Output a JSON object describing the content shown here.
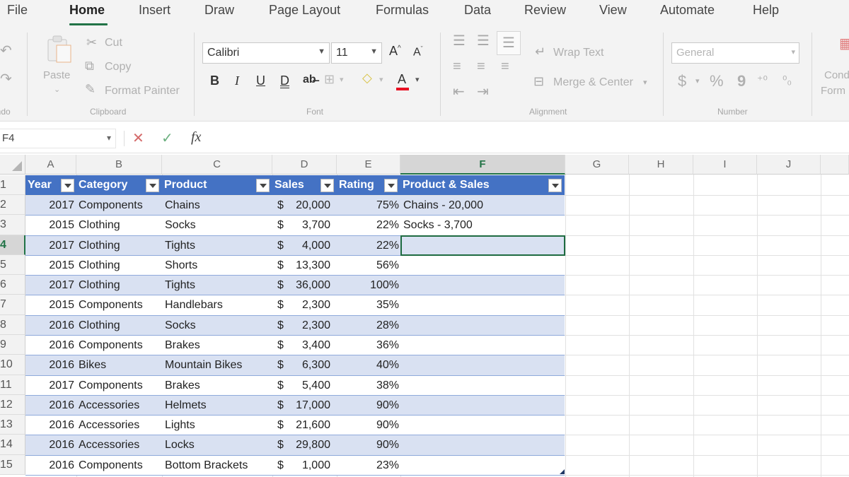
{
  "ribbon_tabs": [
    "File",
    "Home",
    "Insert",
    "Draw",
    "Page Layout",
    "Formulas",
    "Data",
    "Review",
    "View",
    "Automate",
    "Help"
  ],
  "active_tab": "Home",
  "clipboard": {
    "paste_label": "Paste",
    "cut_label": "Cut",
    "copy_label": "Copy",
    "format_painter_label": "Format Painter",
    "group_label": "Clipboard",
    "undo_group_label": "Undo"
  },
  "font": {
    "family": "Calibri",
    "size": "11",
    "grow_label": "A",
    "shrink_label": "A",
    "bold": "B",
    "italic": "I",
    "underline": "U",
    "double_underline": "D",
    "color_label": "A",
    "group_label": "Font",
    "font_color_hex": "#e81123"
  },
  "alignment": {
    "wrap_text_label": "Wrap Text",
    "merge_center_label": "Merge & Center",
    "group_label": "Alignment"
  },
  "number": {
    "format": "General",
    "currency": "$",
    "percent": "%",
    "comma": "9",
    "group_label": "Number"
  },
  "styles": {
    "conditional_label": "Cond",
    "conditional_label2": "Form"
  },
  "formula_bar": {
    "name_box": "F4",
    "cancel": "✕",
    "enter": "✓",
    "fx": "fx",
    "formula": ""
  },
  "columns": [
    "A",
    "B",
    "C",
    "D",
    "E",
    "F",
    "G",
    "H",
    "I",
    "J"
  ],
  "selected_column": "F",
  "rows": [
    "1",
    "2",
    "3",
    "4",
    "5",
    "6",
    "7",
    "8",
    "9",
    "10",
    "11",
    "12",
    "13",
    "14",
    "15"
  ],
  "selected_row": "4",
  "table": {
    "headers": [
      "Year",
      "Category",
      "Product",
      "Sales",
      "Rating",
      "Product & Sales"
    ],
    "header_color": "#4472c4",
    "band_color": "#d9e1f2",
    "records": [
      {
        "year": "2017",
        "category": "Components",
        "product": "Chains",
        "sales": "20,000",
        "rating": "75%",
        "combo": "Chains - 20,000"
      },
      {
        "year": "2015",
        "category": "Clothing",
        "product": "Socks",
        "sales": "3,700",
        "rating": "22%",
        "combo": "Socks - 3,700"
      },
      {
        "year": "2017",
        "category": "Clothing",
        "product": "Tights",
        "sales": "4,000",
        "rating": "22%",
        "combo": ""
      },
      {
        "year": "2015",
        "category": "Clothing",
        "product": "Shorts",
        "sales": "13,300",
        "rating": "56%",
        "combo": ""
      },
      {
        "year": "2017",
        "category": "Clothing",
        "product": "Tights",
        "sales": "36,000",
        "rating": "100%",
        "combo": ""
      },
      {
        "year": "2015",
        "category": "Components",
        "product": "Handlebars",
        "sales": "2,300",
        "rating": "35%",
        "combo": ""
      },
      {
        "year": "2016",
        "category": "Clothing",
        "product": "Socks",
        "sales": "2,300",
        "rating": "28%",
        "combo": ""
      },
      {
        "year": "2016",
        "category": "Components",
        "product": "Brakes",
        "sales": "3,400",
        "rating": "36%",
        "combo": ""
      },
      {
        "year": "2016",
        "category": "Bikes",
        "product": "Mountain Bikes",
        "sales": "6,300",
        "rating": "40%",
        "combo": ""
      },
      {
        "year": "2017",
        "category": "Components",
        "product": "Brakes",
        "sales": "5,400",
        "rating": "38%",
        "combo": ""
      },
      {
        "year": "2016",
        "category": "Accessories",
        "product": "Helmets",
        "sales": "17,000",
        "rating": "90%",
        "combo": ""
      },
      {
        "year": "2016",
        "category": "Accessories",
        "product": "Lights",
        "sales": "21,600",
        "rating": "90%",
        "combo": ""
      },
      {
        "year": "2016",
        "category": "Accessories",
        "product": "Locks",
        "sales": "29,800",
        "rating": "90%",
        "combo": ""
      },
      {
        "year": "2016",
        "category": "Components",
        "product": "Bottom Brackets",
        "sales": "1,000",
        "rating": "23%",
        "combo": ""
      }
    ],
    "currency_symbol": "$"
  }
}
